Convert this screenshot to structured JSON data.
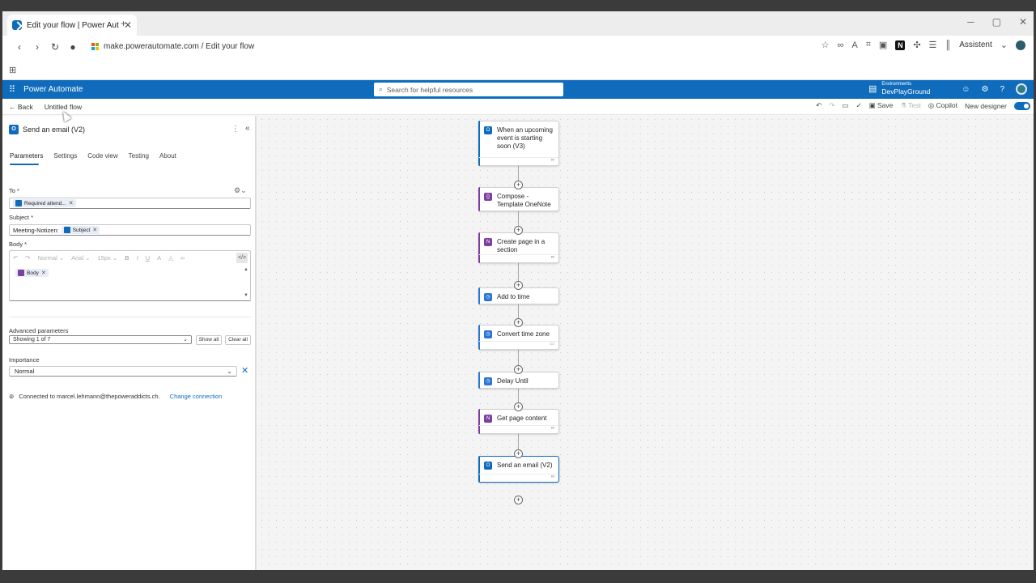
{
  "browser": {
    "tab_title": "Edit your flow | Power Autom",
    "url": "make.powerautomate.com / Edit your flow",
    "assistant_label": "Assistent",
    "n_badge": "N"
  },
  "app": {
    "name": "Power Automate",
    "search_placeholder": "Search for helpful resources",
    "environment_label": "Environments",
    "environment_name": "DevPlayGround"
  },
  "commandbar": {
    "back": "Back",
    "flow_name": "Untitled flow",
    "save": "Save",
    "test": "Test",
    "copilot": "Copilot",
    "new_designer": "New designer"
  },
  "panel": {
    "title": "Send an email (V2)",
    "tabs": [
      "Parameters",
      "Settings",
      "Code view",
      "Testing",
      "About"
    ],
    "to_label": "To *",
    "to_token": "Required attend...",
    "subject_label": "Subject *",
    "subject_prefix": "Meeting-Notizen:",
    "subject_token": "Subject",
    "body_label": "Body *",
    "rte_style": "Normal",
    "rte_font": "Arial",
    "rte_size": "15px",
    "body_token": "Body",
    "advanced_label": "Advanced parameters",
    "advanced_value": "Showing 1 of 7",
    "show_all": "Show all",
    "clear_all": "Clear all",
    "importance_label": "Importance",
    "importance_value": "Normal",
    "connected_text": "Connected to marcel.lehmann@thepoweraddicts.ch.",
    "change_connection": "Change connection"
  },
  "flow_nodes": [
    {
      "title": "When an upcoming event is starting soon (V3)"
    },
    {
      "title": "Compose - Template OneNote"
    },
    {
      "title": "Create page in a section"
    },
    {
      "title": "Add to time"
    },
    {
      "title": "Convert time zone"
    },
    {
      "title": "Delay Until"
    },
    {
      "title": "Get page content"
    },
    {
      "title": "Send an email (V2)"
    }
  ],
  "colors": {
    "brand": "#0f6cbd",
    "onenote": "#7e3ea0"
  }
}
